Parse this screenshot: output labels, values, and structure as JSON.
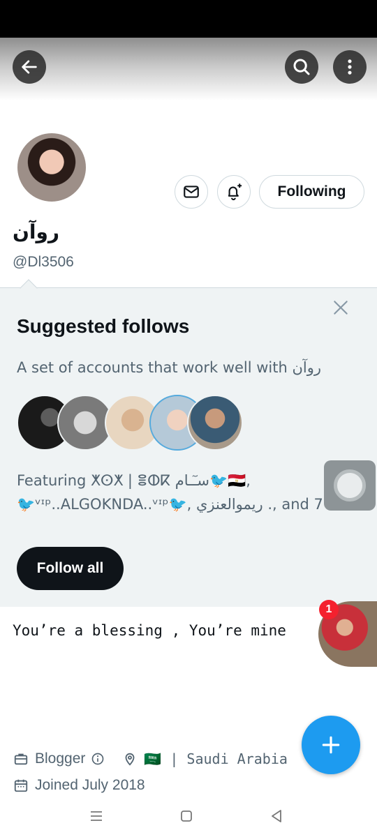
{
  "profile": {
    "display_name": "روآن",
    "handle": "@Dl3506",
    "following_label": "Following",
    "bio": "You’re a blessing , You’re mine",
    "profession": "Blogger",
    "location": "🇸🇦 | Saudi Arabia",
    "joined": "Joined July 2018"
  },
  "suggested": {
    "title": "Suggested follows",
    "description": "A set of accounts that work well with روآن",
    "featuring_line1": "Featuring ⵅⵙⵅ | ⴻⵀⴽ سـٓـام🐦🇪🇬,",
    "featuring_line2": "🐦ᵛᶦᵖ..ALGOKNDA..ᵛᶦᵖ🐦, ريموالعنزي ., and 7",
    "follow_all_label": "Follow all"
  },
  "notification_badge": "1",
  "icons": {
    "back": "arrow-left-icon",
    "search": "search-icon",
    "more": "more-vertical-icon",
    "dm": "envelope-icon",
    "bell": "bell-plus-icon",
    "close": "close-icon",
    "professional": "briefcase-icon",
    "info": "info-icon",
    "location": "location-pin-icon",
    "calendar": "calendar-icon",
    "compose": "plus-icon"
  },
  "colors": {
    "accent": "#1d9bf0",
    "text_primary": "#0f1419",
    "text_secondary": "#536471",
    "panel_bg": "#eff3f4",
    "badge": "#f4212e"
  }
}
